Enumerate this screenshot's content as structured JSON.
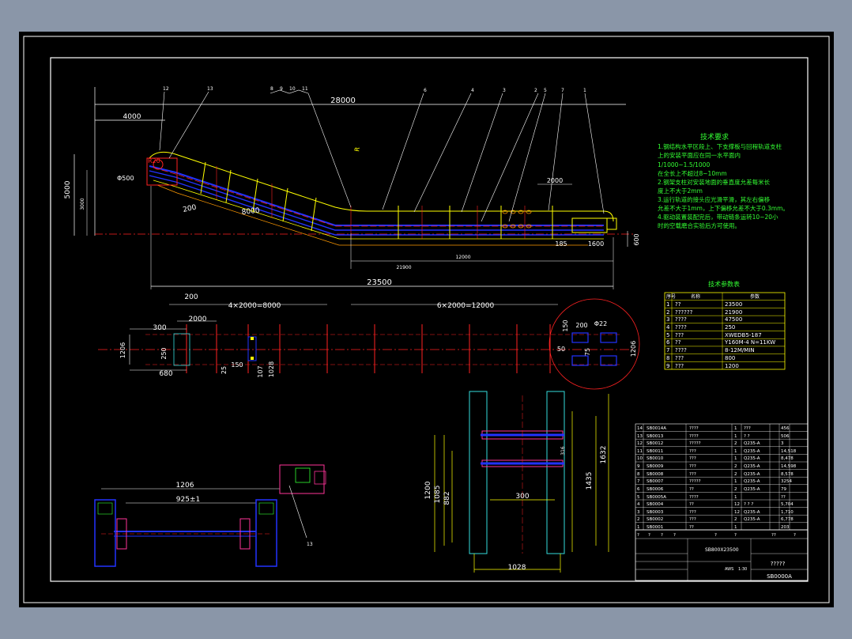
{
  "colors": {
    "background": "#8a96a8",
    "canvas": "#000000",
    "frame": "#ffffff",
    "dimension": "#ffffff",
    "conveyor_chain": "#2233ff",
    "rail": "#ffff00",
    "centerline": "#ff2222",
    "notes": "#33ff33",
    "structure": "#33dddd",
    "drive": "#ff3399"
  },
  "elevation_view": {
    "dims": {
      "total_top": "28000",
      "left_offset": "4000",
      "height": "5000",
      "height_inner": "3000",
      "diameter": "Φ500",
      "r20": "R20",
      "slope_200": "200",
      "slope_8000": "8000",
      "bottom_21900": "21900",
      "bottom_12000": "12000",
      "right_2000": "2000",
      "right_185": "185",
      "right_1600": "1600",
      "right_600": "600",
      "overall": "23500",
      "radius_label": "R"
    },
    "balloons": [
      "12",
      "13",
      "8",
      "9",
      "10",
      "11",
      "6",
      "4",
      "3",
      "2",
      "5",
      "7",
      "1"
    ]
  },
  "technical_requirements": {
    "title": "技术要求",
    "lines": [
      "1.钢结构水平区段上、下支撑板与回程轨道支柱",
      "上的安装平面应在同一水平面内",
      "1/1000~1.5/1000",
      "在全长上不超过8~10mm",
      "2.钢架支柱对安装地面的垂直度允差每米长",
      "度上不大于2mm",
      "3.运行轨道的接头应光滑平滑，其左右偏移",
      "允差不大于1mm，上下偏移允差不大于0.3mm。",
      "4.驱动装置装配完后，带动链条运转10~20小",
      "时的空载磨合实验后方可使用。"
    ]
  },
  "parameter_table": {
    "title": "技术参数表",
    "header": [
      "序号",
      "名称",
      "参数"
    ],
    "rows": [
      [
        "1",
        "??",
        "23500"
      ],
      [
        "2",
        "??????",
        "21900"
      ],
      [
        "3",
        "????",
        "47500"
      ],
      [
        "4",
        "????",
        "250"
      ],
      [
        "5",
        "???",
        "XWEDB5-187"
      ],
      [
        "6",
        "??",
        "Y160M-4  N=11KW"
      ],
      [
        "7",
        "????",
        "8-12M/MIN"
      ],
      [
        "8",
        "???",
        "800"
      ],
      [
        "9",
        "???",
        "1200"
      ]
    ]
  },
  "plan_view": {
    "dims": {
      "d200": "200",
      "d4x2000": "4×2000=8000",
      "d6x2000": "6×2000=12000",
      "d2000": "2000",
      "d300": "300",
      "d1206_left": "1206",
      "d250": "250",
      "d680": "680",
      "d25": "25",
      "d150": "150",
      "d107": "107",
      "d1028": "1028",
      "det_150": "150",
      "det_200": "200",
      "det_phi22": "Φ22",
      "det_50": "50",
      "det_75": "75",
      "d1206_right": "1206"
    }
  },
  "section_view": {
    "dims": {
      "d1632": "1632",
      "d1435": "1435",
      "d1200": "1200",
      "d1085": "1085",
      "d882": "882",
      "d316": "316",
      "d300": "300",
      "d1028": "1028"
    }
  },
  "drive_view": {
    "dims": {
      "d1206": "1206",
      "d925": "925±1"
    },
    "balloon": "13"
  },
  "parts_list": {
    "rows": [
      [
        "14",
        "SB0014A",
        "????",
        "1",
        "???",
        "",
        "456"
      ],
      [
        "13",
        "SB0013",
        "????",
        "1",
        "? ?",
        "",
        "506"
      ],
      [
        "12",
        "SB0012",
        "?????",
        "2",
        "Q235-A",
        "",
        "3"
      ],
      [
        "11",
        "SB0011",
        "???",
        "1",
        "Q235-A",
        "",
        "14,518"
      ],
      [
        "10",
        "SB0010",
        "???",
        "1",
        "Q235-A",
        "",
        "8,478"
      ],
      [
        "9",
        "SB0009",
        "???",
        "2",
        "Q235-A",
        "",
        "14,598"
      ],
      [
        "8",
        "SB0008",
        "???",
        "2",
        "Q235-A",
        "",
        "8,578"
      ],
      [
        "7",
        "SB0007",
        "?????",
        "1",
        "Q235-A",
        "",
        "3254"
      ],
      [
        "6",
        "SB0006",
        "??",
        "2",
        "Q235-A",
        "",
        "79"
      ],
      [
        "5",
        "SB0005A",
        "????",
        "1",
        "",
        "",
        "??"
      ],
      [
        "4",
        "SB0004",
        "??",
        "12",
        "? ? ?",
        "",
        "5,704"
      ],
      [
        "3",
        "SB0003",
        "???",
        "12",
        "Q235-A",
        "",
        "1,710"
      ],
      [
        "2",
        "SB0002",
        "???",
        "2",
        "Q235-A",
        "",
        "6,778"
      ],
      [
        "1",
        "SB0001",
        "??",
        "1",
        "",
        "",
        "203"
      ]
    ],
    "header": [
      "?",
      "?",
      "?",
      "?",
      "?",
      "?",
      "??",
      "?"
    ]
  },
  "title_block": {
    "drawing_name": "SB800X23500",
    "company": "?????",
    "drawing_no": "SB0000A",
    "scale": "1:30",
    "ratio": "AWS"
  }
}
